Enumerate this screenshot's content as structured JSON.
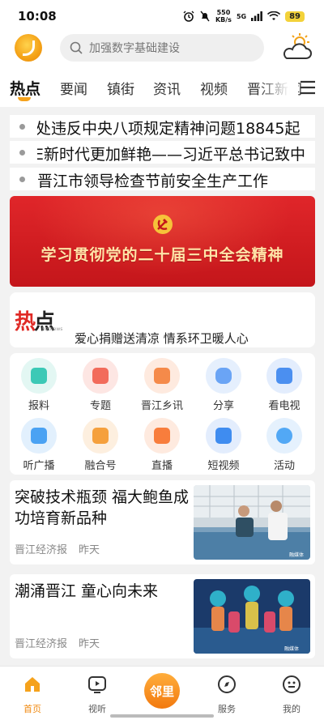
{
  "status": {
    "time": "10:08",
    "speed_value": "550",
    "speed_unit": "KB/s",
    "network": "5G",
    "battery": "89"
  },
  "header": {
    "search_placeholder": "加强数字基础建设",
    "logo_icon": "app-logo-icon",
    "weather_icon": "sun-cloud-icon"
  },
  "tabs": [
    {
      "label": "热点",
      "active": true
    },
    {
      "label": "要闻"
    },
    {
      "label": "镇街"
    },
    {
      "label": "资讯"
    },
    {
      "label": "视频"
    },
    {
      "label": "晋江新闻"
    }
  ],
  "tickers": [
    "处违反中央八项规定精神问题18845起",
    "E新时代更加鲜艳——习近平总书记致中",
    "晋江市领导检查节前安全生产工作"
  ],
  "banner": {
    "text": "学习贯彻党的二十届三中全会精神",
    "color": "#d21f23"
  },
  "hot": {
    "logo_main": "热",
    "logo_second": "点",
    "logo_sub": "hotnews",
    "headline": "爱心捐赠送清凉 情系环卫暖人心"
  },
  "grid": [
    {
      "label": "报料",
      "icon": "camera-icon",
      "color": "#3cc9b6"
    },
    {
      "label": "专题",
      "icon": "star-badge-icon",
      "color": "#f26b5b"
    },
    {
      "label": "晋江乡讯",
      "icon": "news-icon",
      "color": "#f58a4a"
    },
    {
      "label": "分享",
      "icon": "chat-bubble-icon",
      "color": "#6aa4f5"
    },
    {
      "label": "看电视",
      "icon": "tv-icon",
      "color": "#4b8ff0"
    },
    {
      "label": "听广播",
      "icon": "radio-icon",
      "color": "#4aa2f3"
    },
    {
      "label": "融合号",
      "icon": "sparkle-square-icon",
      "color": "#f5a03d"
    },
    {
      "label": "直播",
      "icon": "live-play-icon",
      "color": "#f87d3c"
    },
    {
      "label": "短视频",
      "icon": "video-play-icon",
      "color": "#3f8cf0"
    },
    {
      "label": "活动",
      "icon": "four-squares-icon",
      "color": "#52a8f5"
    }
  ],
  "news": [
    {
      "title": "突破技术瓶颈 福大鲍鱼成功培育新品种",
      "source": "晋江经济报",
      "time": "昨天",
      "thumb_wm": "融媒体"
    },
    {
      "title": "潮涌晋江 童心向未来",
      "source": "晋江经济报",
      "time": "昨天",
      "thumb_wm": "融媒体"
    }
  ],
  "bottom_nav": [
    {
      "label": "首页",
      "icon": "home-icon",
      "active": true
    },
    {
      "label": "视听",
      "icon": "play-square-icon"
    },
    {
      "label": "邻里",
      "icon": "center-logo-icon",
      "center": true
    },
    {
      "label": "服务",
      "icon": "compass-icon"
    },
    {
      "label": "我的",
      "icon": "smiley-face-icon"
    }
  ],
  "colors": {
    "accent": "#f5a21c",
    "nav_active": "#f08a12"
  }
}
